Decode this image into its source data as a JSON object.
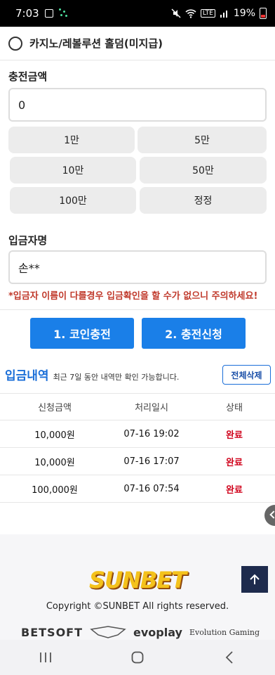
{
  "status_bar": {
    "time": "7:03",
    "battery": "19%",
    "network": "LTE"
  },
  "payment_method": {
    "label": "카지노/레볼루션 홀덤(미지급)"
  },
  "charge": {
    "label": "충전금액",
    "amount_value": "0",
    "amount_buttons": [
      "1만",
      "5만",
      "10만",
      "50만",
      "100만",
      "정정"
    ]
  },
  "depositor": {
    "label": "입금자명",
    "value": "손**",
    "warning": "*입금자 이름이 다를경우 입금확인을 할 수가 없으니 주의하세요!"
  },
  "actions": {
    "coin_charge": "1. 코인충전",
    "charge_request": "2. 충전신청"
  },
  "history": {
    "title": "입금내역",
    "description": "최근 7일 동안 내역만 확인 가능합니다.",
    "delete_all": "전체삭제",
    "columns": [
      "신청금액",
      "처리일시",
      "상태"
    ],
    "rows": [
      {
        "amount": "10,000원",
        "datetime": "07-16 19:02",
        "status": "완료"
      },
      {
        "amount": "10,000원",
        "datetime": "07-16 17:07",
        "status": "완료"
      },
      {
        "amount": "100,000원",
        "datetime": "07-16 07:54",
        "status": "완료"
      }
    ]
  },
  "footer": {
    "logo_text": "SUNBET",
    "copyright": "Copyright ©SUNBET All rights reserved.",
    "partners": [
      "BETSOFT",
      "evoplay",
      "Evolution Gaming"
    ]
  },
  "colors": {
    "primary": "#1a7fe8",
    "accent_red": "#d0021b",
    "title_blue": "#1a6ed8"
  }
}
